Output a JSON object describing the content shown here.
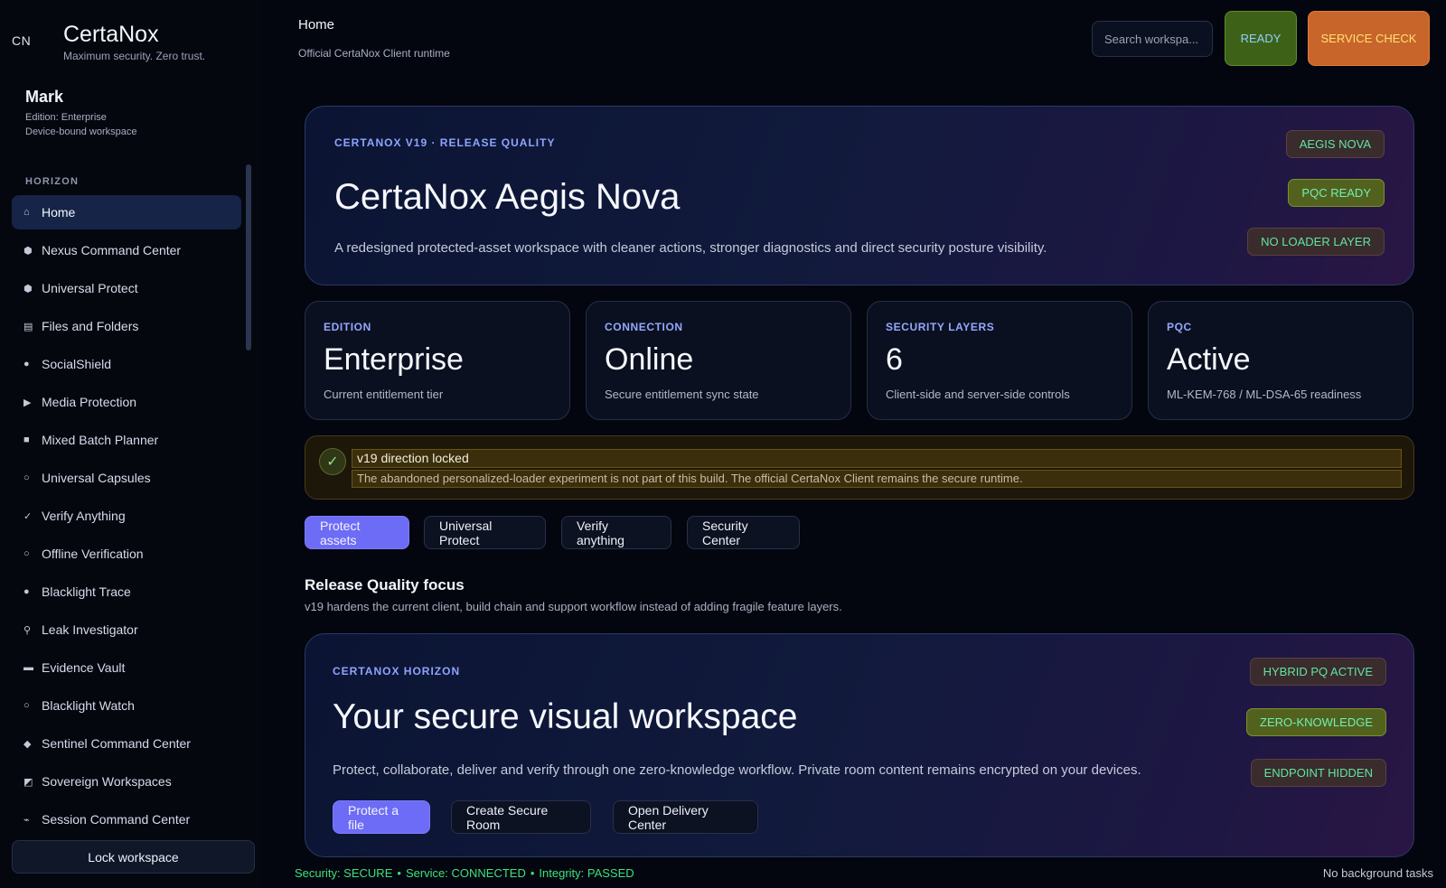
{
  "brand": {
    "short": "CN",
    "name": "CertaNox",
    "tagline": "Maximum security. Zero trust."
  },
  "user": {
    "name": "Mark",
    "edition": "Edition: Enterprise",
    "device": "Device-bound workspace"
  },
  "sidebar": {
    "section": "HORIZON",
    "items": [
      {
        "label": "Home",
        "icon": "⌂"
      },
      {
        "label": "Nexus Command Center",
        "icon": "⬢"
      },
      {
        "label": "Universal Protect",
        "icon": "⬢"
      },
      {
        "label": "Files and Folders",
        "icon": "▤"
      },
      {
        "label": "SocialShield",
        "icon": "●"
      },
      {
        "label": "Media Protection",
        "icon": "▶"
      },
      {
        "label": "Mixed Batch Planner",
        "icon": "■"
      },
      {
        "label": "Universal Capsules",
        "icon": "○"
      },
      {
        "label": "Verify Anything",
        "icon": "✓"
      },
      {
        "label": "Offline Verification",
        "icon": "○"
      },
      {
        "label": "Blacklight Trace",
        "icon": "●"
      },
      {
        "label": "Leak Investigator",
        "icon": "⚲"
      },
      {
        "label": "Evidence Vault",
        "icon": "▬"
      },
      {
        "label": "Blacklight Watch",
        "icon": "○"
      },
      {
        "label": "Sentinel Command Center",
        "icon": "◆"
      },
      {
        "label": "Sovereign Workspaces",
        "icon": "◩"
      },
      {
        "label": "Session Command Center",
        "icon": "⌁"
      }
    ],
    "lock_label": "Lock workspace"
  },
  "header": {
    "title": "Home",
    "subtitle": "Official CertaNox Client runtime",
    "search_placeholder": "Search workspa...",
    "ready_label": "READY",
    "service_label": "SERVICE CHECK"
  },
  "hero": {
    "kicker": "CERTANOX V19 · RELEASE QUALITY",
    "title": "CertaNox Aegis Nova",
    "description": "A redesigned protected-asset workspace with cleaner actions, stronger diagnostics and direct security posture visibility.",
    "badges": [
      "AEGIS NOVA",
      "PQC READY",
      "NO LOADER LAYER"
    ]
  },
  "stats": [
    {
      "label": "EDITION",
      "value": "Enterprise",
      "sub": "Current entitlement tier"
    },
    {
      "label": "CONNECTION",
      "value": "Online",
      "sub": "Secure entitlement sync state"
    },
    {
      "label": "SECURITY LAYERS",
      "value": "6",
      "sub": "Client-side and server-side controls"
    },
    {
      "label": "PQC",
      "value": "Active",
      "sub": "ML-KEM-768 / ML-DSA-65 readiness"
    }
  ],
  "banner": {
    "icon": "✓",
    "title": "v19 direction locked",
    "text": "The abandoned personalized-loader experiment is not part of this build. The official CertaNox Client remains the secure runtime."
  },
  "actions": [
    "Protect assets",
    "Universal Protect",
    "Verify anything",
    "Security Center"
  ],
  "focus": {
    "title": "Release Quality focus",
    "description": "v19 hardens the current client, build chain and support workflow instead of adding fragile feature layers."
  },
  "horizon": {
    "kicker": "CERTANOX HORIZON",
    "title": "Your secure visual workspace",
    "description": "Protect, collaborate, deliver and verify through one zero-knowledge workflow. Private room content remains encrypted on your devices.",
    "badges": [
      "HYBRID PQ ACTIVE",
      "ZERO-KNOWLEDGE",
      "ENDPOINT HIDDEN"
    ],
    "buttons": [
      "Protect a file",
      "Create Secure Room",
      "Open Delivery Center"
    ]
  },
  "status": {
    "security": "Security: SECURE",
    "service": "Service: CONNECTED",
    "integrity": "Integrity: PASSED",
    "separator": "•",
    "background": "No background tasks"
  }
}
